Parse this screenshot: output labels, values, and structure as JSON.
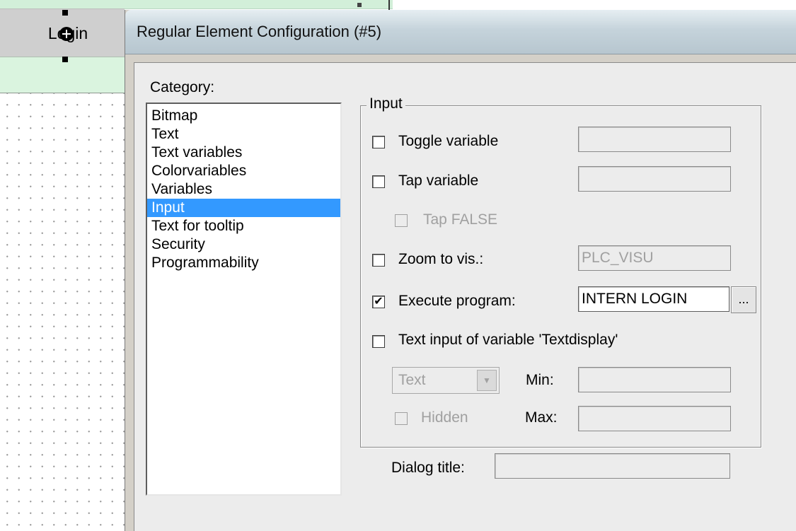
{
  "editor": {
    "login_label": "Login"
  },
  "dialog": {
    "title": "Regular Element Configuration (#5)",
    "category_label": "Category:",
    "categories": [
      "Bitmap",
      "Text",
      "Text variables",
      "Colorvariables",
      "Variables",
      "Input",
      "Text for tooltip",
      "Security",
      "Programmability"
    ],
    "selected_category": "Input",
    "input_group": {
      "legend": "Input",
      "toggle_variable": {
        "label": "Toggle variable",
        "checked": false,
        "value": ""
      },
      "tap_variable": {
        "label": "Tap variable",
        "checked": false,
        "value": ""
      },
      "tap_false": {
        "label": "Tap FALSE",
        "checked": false,
        "enabled": false
      },
      "zoom_to_vis": {
        "label": "Zoom to vis.:",
        "checked": false,
        "value": "PLC_VISU"
      },
      "execute_program": {
        "label": "Execute program:",
        "checked": true,
        "check_mark": "✔",
        "value": "INTERN LOGIN",
        "browse_label": "..."
      },
      "text_input": {
        "label": "Text input of variable 'Textdisplay'",
        "checked": false
      },
      "input_type": {
        "selected": "Text",
        "enabled": false
      },
      "min": {
        "label": "Min:",
        "value": ""
      },
      "hidden": {
        "label": "Hidden",
        "checked": false,
        "enabled": false
      },
      "max": {
        "label": "Max:",
        "value": ""
      }
    },
    "dialog_title": {
      "label": "Dialog title:",
      "value": ""
    }
  },
  "colors": {
    "selection": "#3399ff",
    "dialog_face": "#ececec",
    "disabled_text": "#a0a0a0"
  },
  "icons": [
    "crosshair-cursor-icon",
    "check-mark-icon",
    "dropdown-arrow-icon"
  ]
}
